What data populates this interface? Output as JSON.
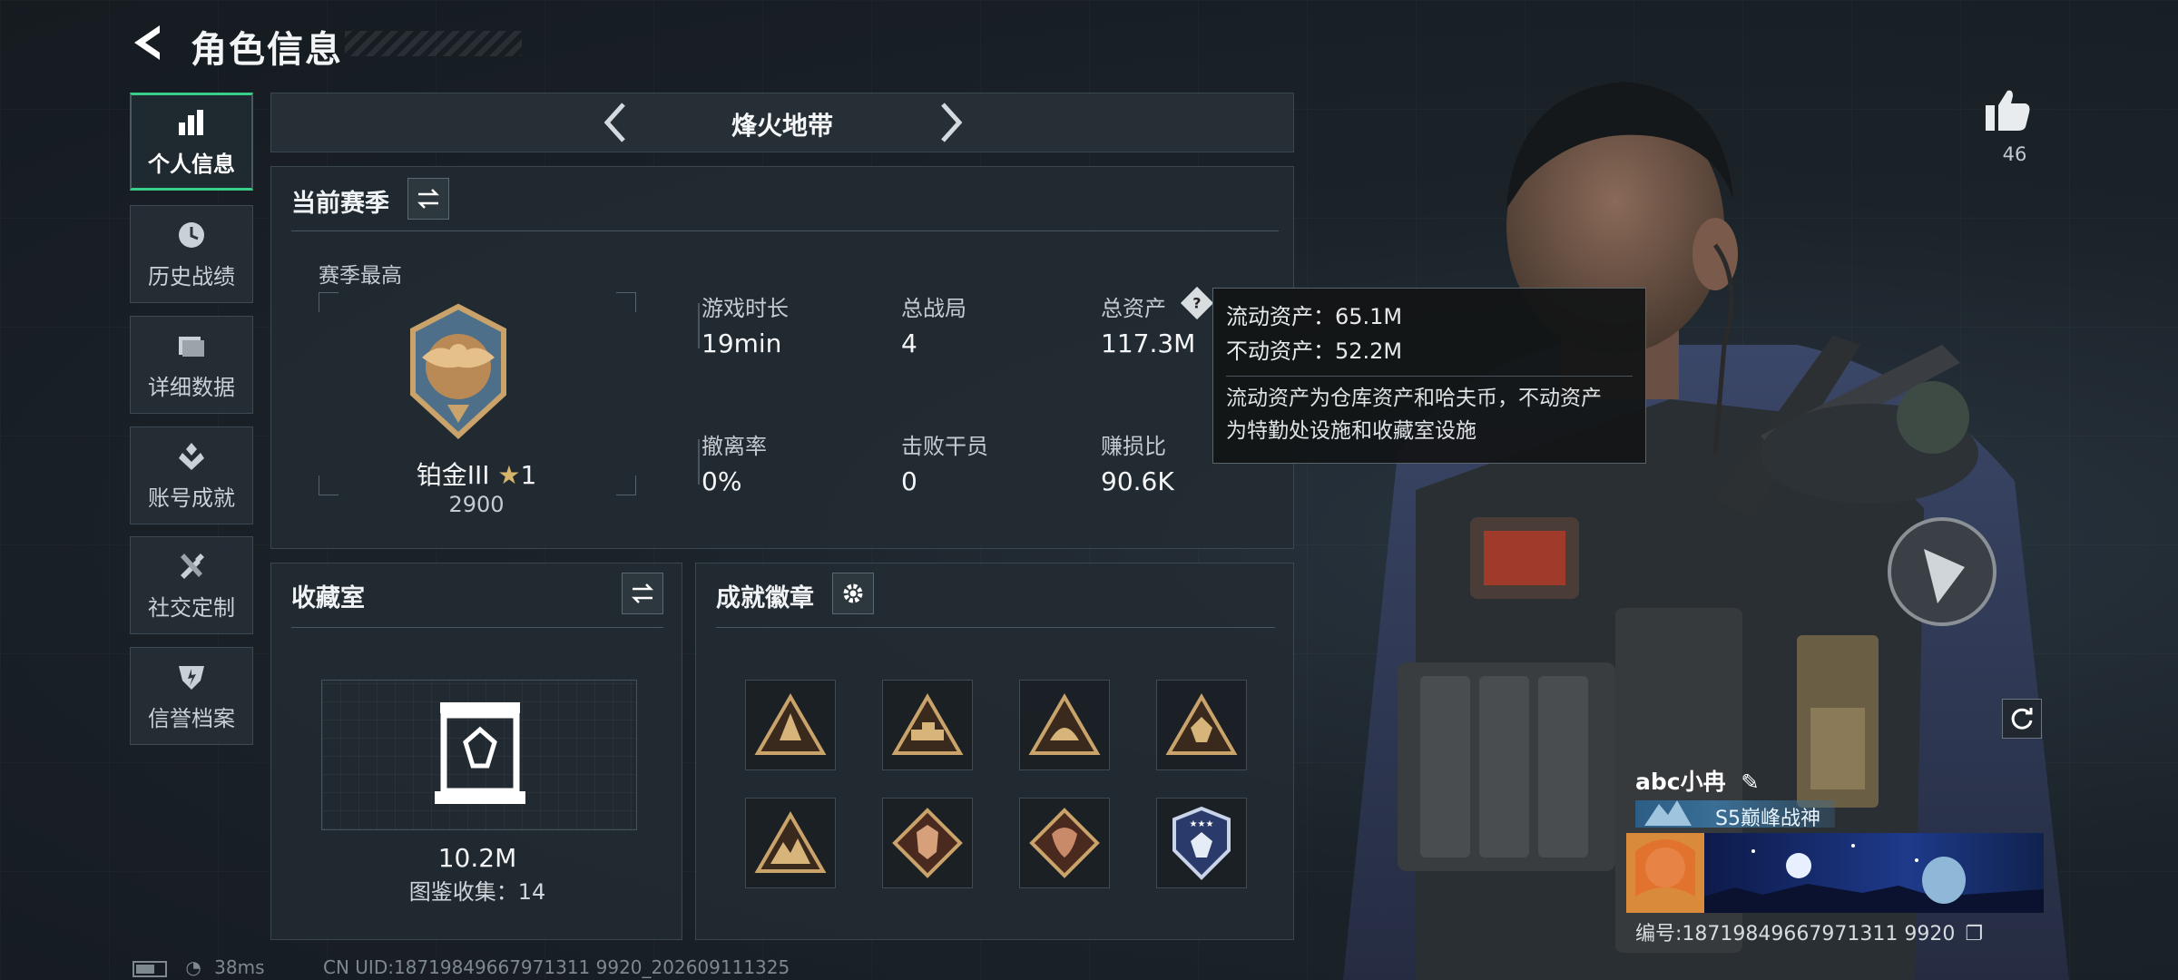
{
  "header": {
    "title": "角色信息"
  },
  "sidebar": {
    "items": [
      {
        "label": "个人信息",
        "icon": "bar-chart-icon",
        "active": true
      },
      {
        "label": "历史战绩",
        "icon": "clock-icon"
      },
      {
        "label": "详细数据",
        "icon": "folder-icon"
      },
      {
        "label": "账号成就",
        "icon": "achievement-icon"
      },
      {
        "label": "社交定制",
        "icon": "tools-icon"
      },
      {
        "label": "信誉档案",
        "icon": "shield-icon"
      }
    ]
  },
  "mode": {
    "title": "烽火地带"
  },
  "season": {
    "title": "当前赛季",
    "best_label": "赛季最高",
    "rank_name": "铂金III",
    "rank_stars": "1",
    "rank_score": "2900",
    "stats": [
      {
        "label": "游戏时长",
        "value": "19min"
      },
      {
        "label": "总战局",
        "value": "4"
      },
      {
        "label": "总资产",
        "value": "117.3M"
      },
      {
        "label": "撤离率",
        "value": "0%"
      },
      {
        "label": "击败干员",
        "value": "0"
      },
      {
        "label": "赚损比",
        "value": "90.6K"
      }
    ]
  },
  "tooltip": {
    "liquid": "流动资产：65.1M",
    "fixed": "不动资产：52.2M",
    "desc_line1": "流动资产为仓库资产和哈夫币，不动资产",
    "desc_line2": "为特勤处设施和收藏室设施"
  },
  "collection": {
    "title": "收藏室",
    "value": "10.2M",
    "catalog": "图鉴收集：14"
  },
  "badges": {
    "title": "成就徽章",
    "items": [
      "badge-1",
      "badge-2",
      "badge-3",
      "badge-4",
      "badge-5",
      "badge-6",
      "badge-7",
      "badge-8"
    ]
  },
  "profile": {
    "likes": "46",
    "name": "abc小冉",
    "title": "S5巅峰战神",
    "id": "编号:18719849667971311 9920"
  },
  "status": {
    "ping": "38ms",
    "uid": "CN UID:18719849667971311 9920_202609111325"
  },
  "colors": {
    "accent": "#37d08a",
    "gold": "#c9a36a",
    "panel": "#232b32"
  }
}
